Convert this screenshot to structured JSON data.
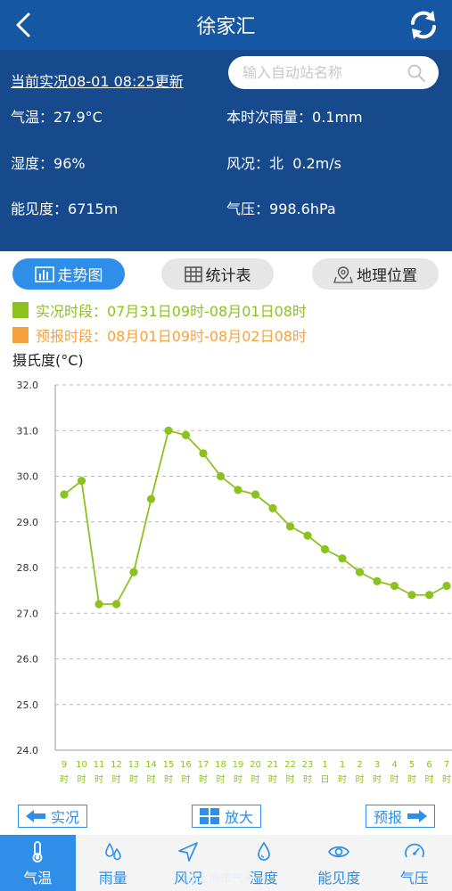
{
  "header": {
    "title": "徐家汇",
    "update_text": "当前实况08-01 08:25更新",
    "search_placeholder": "输入自动站名称"
  },
  "observations": {
    "temp_label": "气温：",
    "temp_value": "27.9°C",
    "rain_label": "本时次雨量：",
    "rain_value": "0.1mm",
    "humidity_label": "湿度：",
    "humidity_value": "96%",
    "wind_label": "风况：",
    "wind_value": "北  0.2m/s",
    "visibility_label": "能见度：",
    "visibility_value": "6715m",
    "pressure_label": "气压：",
    "pressure_value": "998.6hPa"
  },
  "tabs": [
    {
      "label": "走势图",
      "active": true
    },
    {
      "label": "统计表",
      "active": false
    },
    {
      "label": "地理位置",
      "active": false
    }
  ],
  "legend": {
    "actual": "实况时段：07月31日09时-08月01日08时",
    "forecast": "预报时段：08月01日09时-08月02日08时"
  },
  "unit_label": "摄氏度(°C)",
  "colors": {
    "primary": "#1557a3",
    "header_bg": "#164a8c",
    "accent": "#2e8ee8",
    "actual_line": "#8cc21e",
    "forecast": "#f7a23c"
  },
  "chart_data": {
    "type": "line",
    "ylim": [
      24.0,
      32.0
    ],
    "y_ticks": [
      "32.0",
      "31.0",
      "30.0",
      "29.0",
      "28.0",
      "27.0",
      "26.0",
      "25.0",
      "24.0"
    ],
    "categories": [
      "9时",
      "10时",
      "11时",
      "12时",
      "13时",
      "14时",
      "15时",
      "16时",
      "17时",
      "18时",
      "19时",
      "20时",
      "21时",
      "22时",
      "23时",
      "1日",
      "1时",
      "2时",
      "3时",
      "4时",
      "5时",
      "6时",
      "7时"
    ],
    "values": [
      29.6,
      29.9,
      27.2,
      27.2,
      27.9,
      29.5,
      31.0,
      30.9,
      30.5,
      30.0,
      29.7,
      29.6,
      29.3,
      28.9,
      28.7,
      28.4,
      28.2,
      27.9,
      27.7,
      27.6,
      27.4,
      27.4,
      27.6
    ],
    "grid": true
  },
  "nav": {
    "prev": "实况",
    "zoom": "放大",
    "next": "预报"
  },
  "bottom_tabs": [
    {
      "label": "气温",
      "icon": "thermometer-icon",
      "active": true
    },
    {
      "label": "雨量",
      "icon": "raindrops-icon",
      "active": false
    },
    {
      "label": "风况",
      "icon": "wind-arrow-icon",
      "active": false
    },
    {
      "label": "湿度",
      "icon": "humidity-drop-icon",
      "active": false
    },
    {
      "label": "能见度",
      "icon": "eye-icon",
      "active": false
    },
    {
      "label": "气压",
      "icon": "gauge-icon",
      "active": false
    }
  ],
  "watermark": "@上海市气象"
}
